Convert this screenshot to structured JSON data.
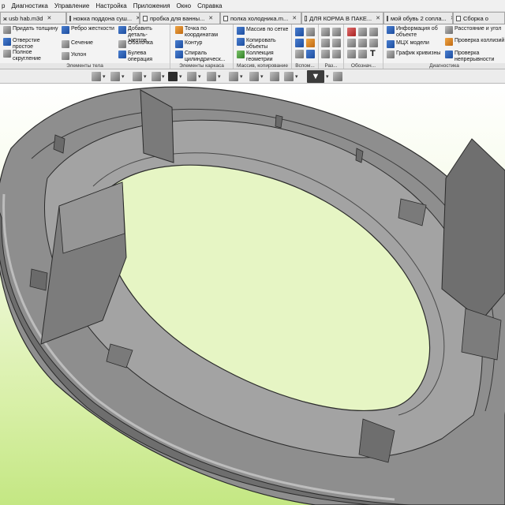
{
  "menubar": {
    "items": [
      {
        "label": "р"
      },
      {
        "label": "Диагностика"
      },
      {
        "label": "Управление"
      },
      {
        "label": "Настройка"
      },
      {
        "label": "Приложения"
      },
      {
        "label": "Окно"
      },
      {
        "label": "Справка"
      }
    ]
  },
  "tabs": [
    {
      "label": "ж usb hab.m3d"
    },
    {
      "label": "ножка поддона суш..."
    },
    {
      "label": "пробка для ванны..."
    },
    {
      "label": "полка холодника.m..."
    },
    {
      "label": "ДЛЯ КОРМА В ПАКЕ..."
    },
    {
      "label": "мой обувь 2 сопла..."
    },
    {
      "label": "Сборка о"
    }
  ],
  "ribbon": {
    "body_elements": {
      "group_label": "Элементы тела",
      "items": [
        {
          "label": "Придать толщину"
        },
        {
          "label": "Отверстие простое"
        },
        {
          "label": "Полное скругление"
        },
        {
          "label": "Ребро жесткости"
        },
        {
          "label": "Сечение"
        },
        {
          "label": "Уклон"
        },
        {
          "label": "Добавить деталь-заготов..."
        },
        {
          "label": "Оболочка"
        },
        {
          "label": "Булева операция"
        }
      ]
    },
    "frame_elements": {
      "group_label": "Элементы каркаса",
      "items": [
        {
          "label": "Точка по координатам"
        },
        {
          "label": "Контур"
        },
        {
          "label": "Спираль цилиндрическ..."
        }
      ]
    },
    "arrays": {
      "group_label": "Массив, копирование",
      "items": [
        {
          "label": "Массив по сетке"
        },
        {
          "label": "Копировать объекты"
        },
        {
          "label": "Коллекция геометрии"
        }
      ]
    },
    "aux_label": "Вспом...",
    "sizes_label": "Раз...",
    "designations_label": "Обознач...",
    "diagnostics": {
      "group_label": "Диагностика",
      "items": [
        {
          "label": "Информация об объекте"
        },
        {
          "label": "МЦХ модели"
        },
        {
          "label": "График кривизны"
        },
        {
          "label": "Расстояние и угол"
        },
        {
          "label": "Проверка коллизий"
        },
        {
          "label": "Проверка непрерывности"
        }
      ]
    }
  },
  "viewport": {
    "background_top": "#ffffff",
    "background_bottom": "#c4e783",
    "model_fill": "#8e8e8e",
    "model_edge": "#2b2b2b"
  }
}
